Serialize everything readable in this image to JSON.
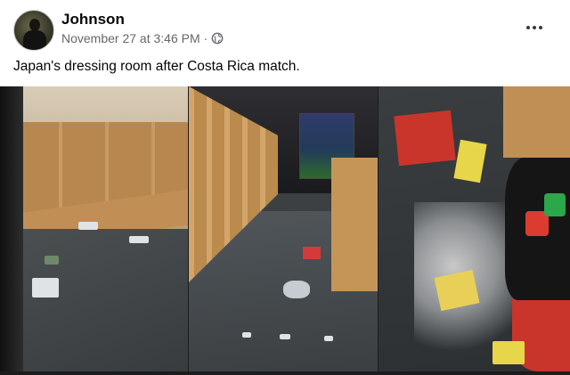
{
  "post": {
    "author": "Johnson",
    "timestamp": "November 27 at 3:46 PM",
    "separator": "·",
    "audience_icon": "globe-icon",
    "more_icon": "ellipsis-icon",
    "caption": "Japan's dressing room after Costa Rica match."
  },
  "media": {
    "panels": [
      "dressing-room-left",
      "dressing-room-center",
      "dressing-room-right"
    ]
  },
  "colors": {
    "name_text": "#050505",
    "meta_text": "#65676b",
    "background": "#ffffff"
  }
}
